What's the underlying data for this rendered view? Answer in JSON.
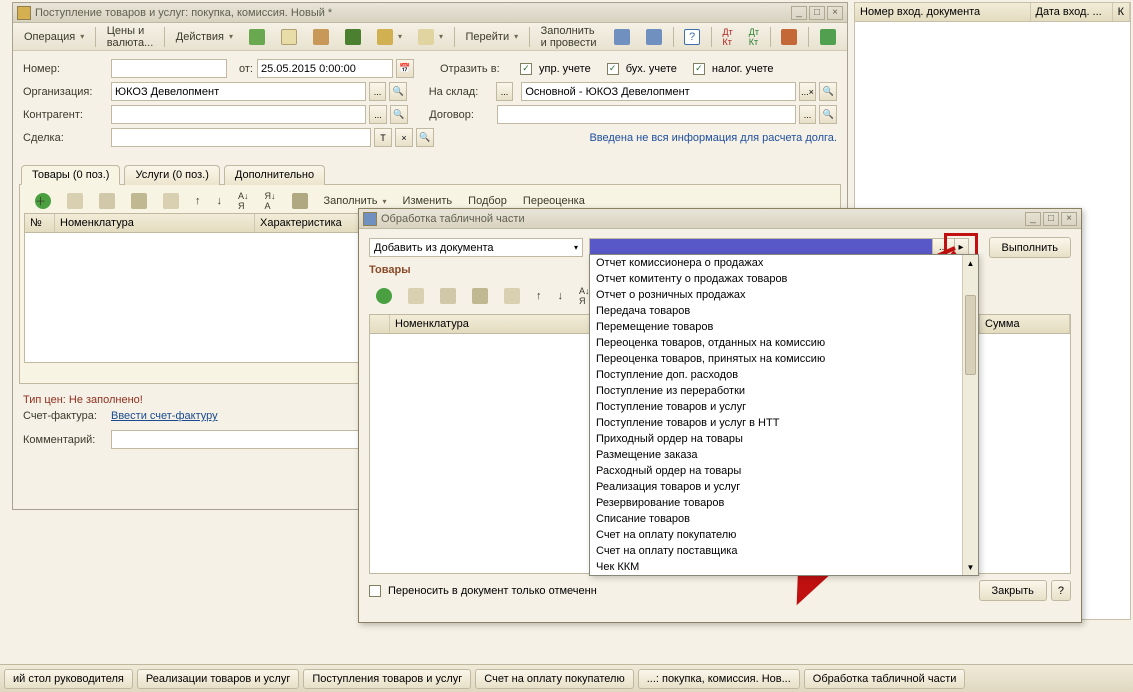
{
  "mainWindow": {
    "title": "Поступление товаров и услуг: покупка, комиссия. Новый *",
    "toolbar": {
      "operation": "Операция",
      "prices": "Цены и валюта...",
      "actions": "Действия",
      "goto": "Перейти",
      "fillPost": "Заполнить и провести"
    },
    "fields": {
      "numberLbl": "Номер:",
      "fromLbl": "от:",
      "date": "25.05.2015  0:00:00",
      "orgLbl": "Организация:",
      "org": "ЮКОЗ Девелопмент",
      "contrLbl": "Контрагент:",
      "dealLbl": "Сделка:",
      "reflectLbl": "Отразить в:",
      "chk1": "упр. учете",
      "chk2": "бух. учете",
      "chk3": "налог. учете",
      "whLbl": "На склад:",
      "wh": "Основной - ЮКОЗ Девелопмент",
      "contractLbl": "Договор:",
      "debtInfo": "Введена не вся информация для расчета долга."
    },
    "tabs": {
      "t1": "Товары (0 поз.)",
      "t2": "Услуги (0 поз.)",
      "t3": "Дополнительно"
    },
    "tabToolbar": {
      "fill": "Заполнить",
      "change": "Изменить",
      "pick": "Подбор",
      "reval": "Переоценка"
    },
    "gridCols": {
      "c1": "№",
      "c2": "Номенклатура",
      "c3": "Характеристика"
    },
    "bottom": {
      "priceType": "Тип цен: Не заполнено!",
      "sfLbl": "Счет-фактура:",
      "sfLink": "Ввести счет-фактуру",
      "commentLbl": "Комментарий:"
    }
  },
  "rightCols": {
    "c1": "Номер вход. документа",
    "c2": "Дата вход. ...",
    "c3": "К"
  },
  "dialog": {
    "title": "Обработка табличной части",
    "comboLabel": "Добавить из документа",
    "execute": "Выполнить",
    "subhead": "Товары",
    "gridCols": {
      "c1": "Номенклатура",
      "c2": "Сумма"
    },
    "transferChk": "Переносить в документ только отмеченн",
    "close": "Закрыть"
  },
  "dropdown": [
    "Отчет комиссионера о продажах",
    "Отчет комитенту о продажах товаров",
    "Отчет о розничных продажах",
    "Передача товаров",
    "Перемещение товаров",
    "Переоценка товаров, отданных на комиссию",
    "Переоценка товаров, принятых на комиссию",
    "Поступление доп. расходов",
    "Поступление из переработки",
    "Поступление товаров и услуг",
    "Поступление товаров и услуг в НТТ",
    "Приходный ордер на товары",
    "Размещение заказа",
    "Расходный ордер на товары",
    "Реализация товаров и услуг",
    "Резервирование товаров",
    "Списание товаров",
    "Счет на оплату покупателю",
    "Счет на оплату поставщика",
    "Чек ККМ"
  ],
  "taskbar": {
    "t1": "ий стол руководителя",
    "t2": "Реализации товаров и услуг",
    "t3": "Поступления товаров и услуг",
    "t4": "Счет на оплату покупателю",
    "t5": "...: покупка, комиссия. Нов...",
    "t6": "Обработка табличной части"
  }
}
